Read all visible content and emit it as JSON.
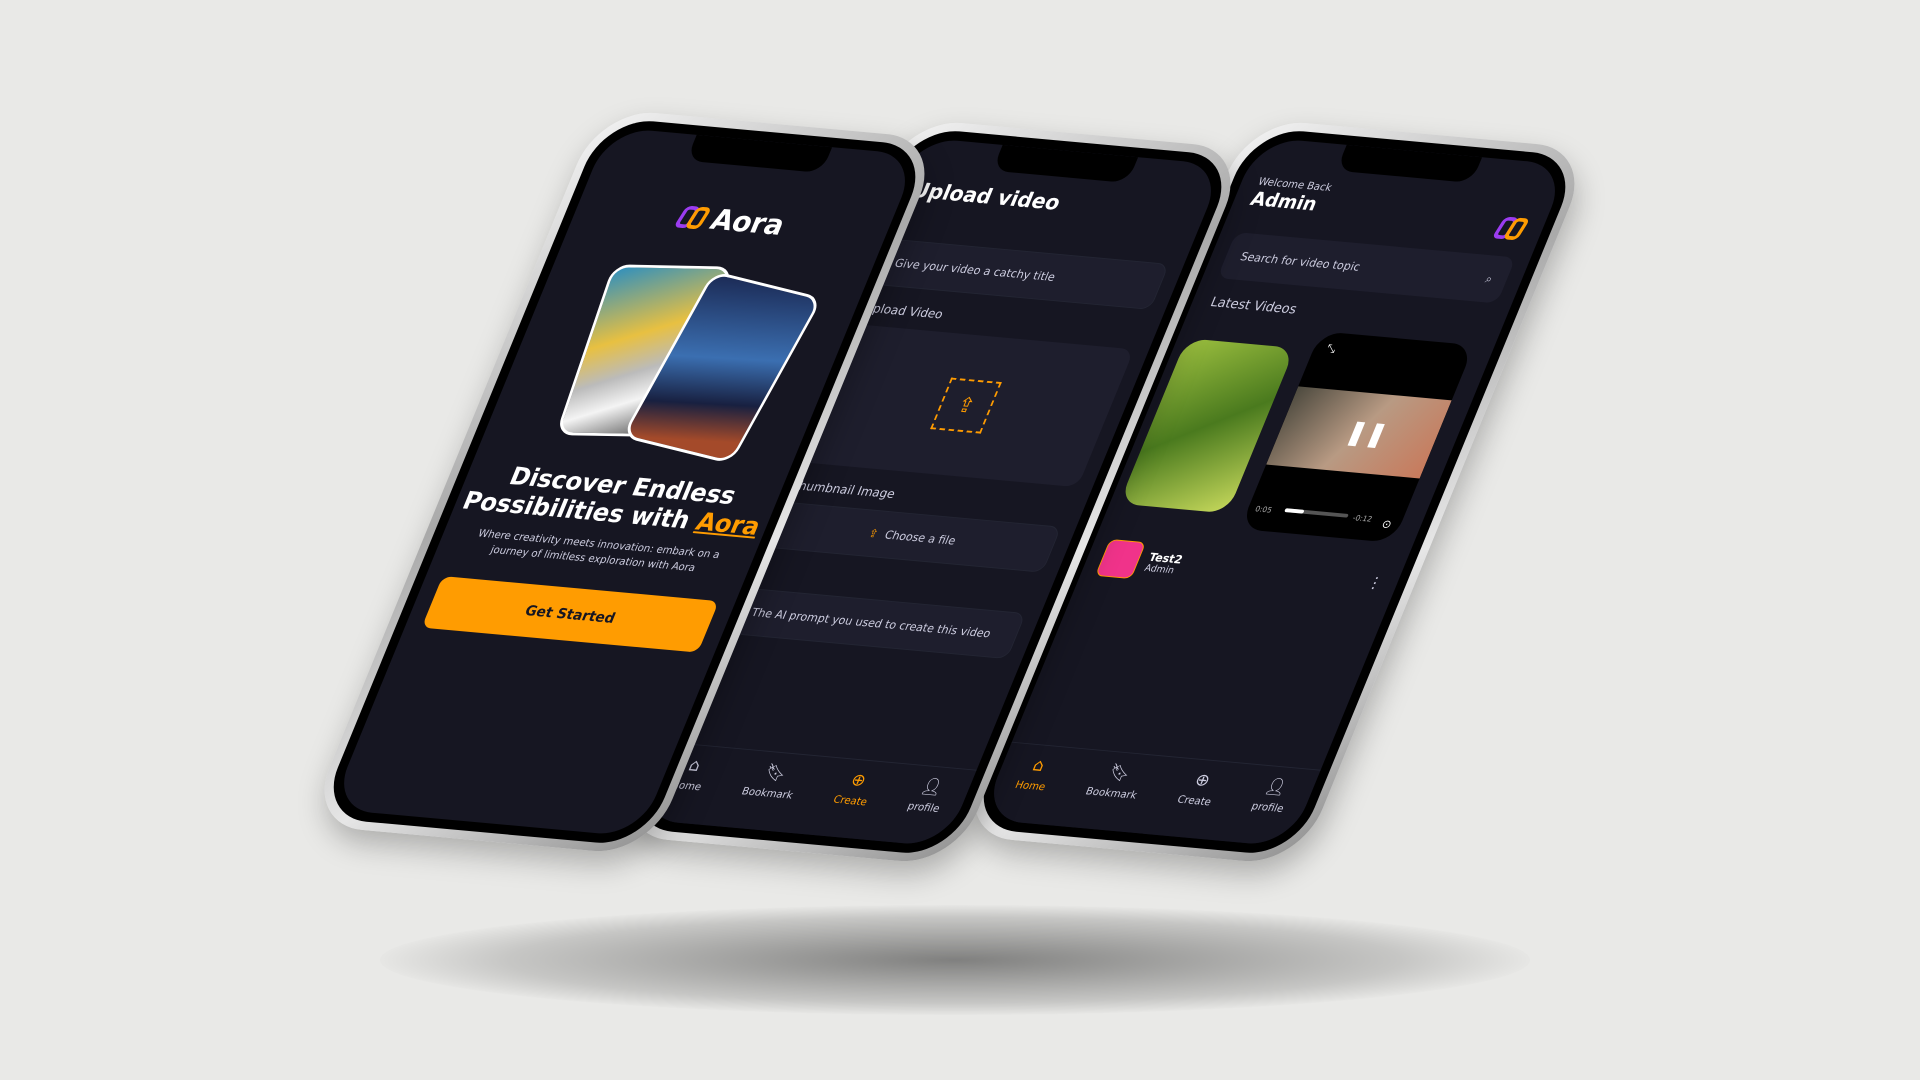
{
  "colors": {
    "background": "#e9e9e7",
    "screen": "#161622",
    "accent": "#ff9c01",
    "brand_purple": "#9b3cf0"
  },
  "onboarding": {
    "logo_text": "Aora",
    "headline": "Discover Endless Possibilities with",
    "headline_highlight": "Aora",
    "subtitle": "Where creativity meets innovation: embark on a journey of limitless exploration with Aora",
    "cta": "Get Started"
  },
  "upload": {
    "title": "Upload video",
    "title_placeholder": "Give your video a catchy title",
    "video_label": "Upload Video",
    "upload_icon": "upload-icon",
    "thumbnail_label": "Thumbnail Image",
    "choose_file": "Choose a file",
    "prompt_placeholder": "The AI prompt you used to create this video"
  },
  "home": {
    "welcome": "Welcome Back",
    "username": "Admin",
    "search_placeholder": "Search for video topic",
    "section_title": "Latest Videos",
    "player": {
      "elapsed": "0:05",
      "remaining": "-0:12",
      "progress": 0.3
    },
    "video": {
      "title": "Test2",
      "creator": "Admin"
    }
  },
  "tabs": [
    {
      "label": "Home",
      "icon": "home-icon"
    },
    {
      "label": "Bookmark",
      "icon": "bookmark-icon"
    },
    {
      "label": "Create",
      "icon": "plus-circle-icon"
    },
    {
      "label": "profile",
      "icon": "profile-icon"
    }
  ]
}
